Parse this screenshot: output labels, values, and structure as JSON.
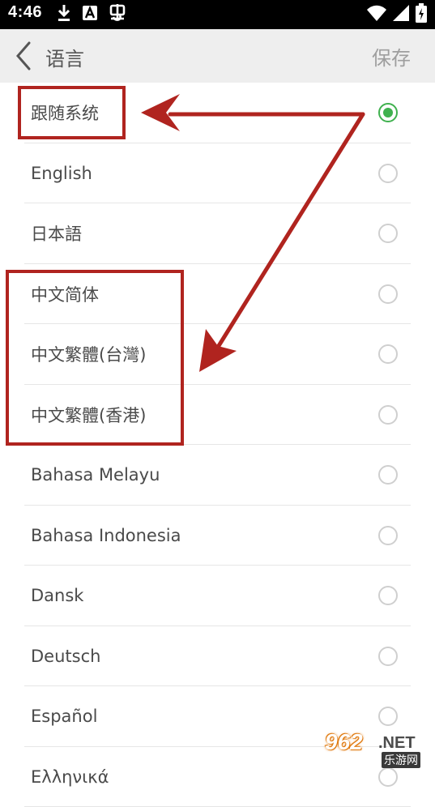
{
  "status": {
    "time": "4:46",
    "left_icons": [
      "download-icon",
      "a-box-icon",
      "bug-icon"
    ],
    "right_icons": [
      "wifi-icon",
      "signal-icon",
      "battery-charging-icon"
    ]
  },
  "header": {
    "back_icon": "chevron-left-icon",
    "title": "语言",
    "save_label": "保存"
  },
  "languages": [
    {
      "label": "跟随系统",
      "selected": true
    },
    {
      "label": "English",
      "selected": false
    },
    {
      "label": "日本語",
      "selected": false
    },
    {
      "label": "中文简体",
      "selected": false
    },
    {
      "label": "中文繁體(台灣)",
      "selected": false
    },
    {
      "label": "中文繁體(香港)",
      "selected": false
    },
    {
      "label": "Bahasa Melayu",
      "selected": false
    },
    {
      "label": "Bahasa Indonesia",
      "selected": false
    },
    {
      "label": "Dansk",
      "selected": false
    },
    {
      "label": "Deutsch",
      "selected": false
    },
    {
      "label": "Español",
      "selected": false
    },
    {
      "label": "Ελληνικά",
      "selected": false
    }
  ],
  "colors": {
    "accent": "#3fb14e",
    "annotation": "#b0241f",
    "header_bg": "#eeeeee"
  },
  "watermark": {
    "main": "962",
    "suffix": ".NET",
    "sub": "乐游网"
  }
}
